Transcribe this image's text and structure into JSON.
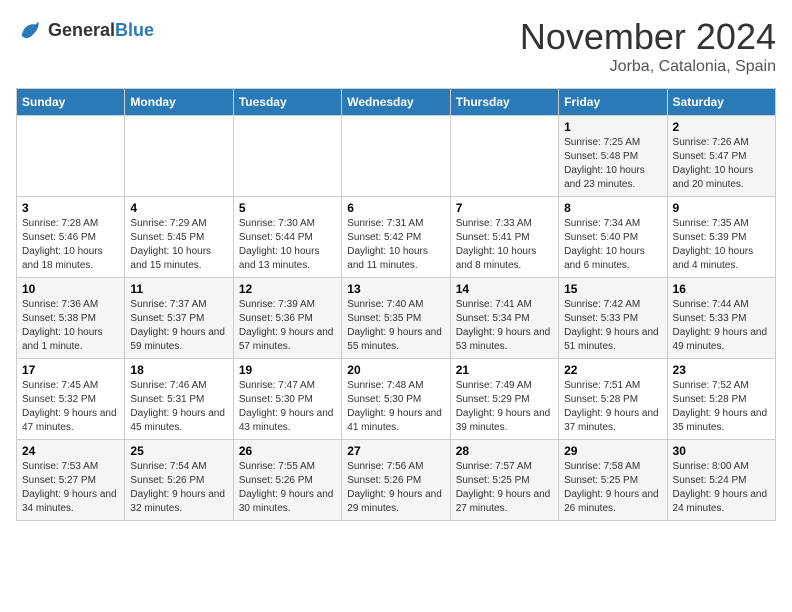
{
  "header": {
    "logo_general": "General",
    "logo_blue": "Blue",
    "month_title": "November 2024",
    "location": "Jorba, Catalonia, Spain"
  },
  "days_of_week": [
    "Sunday",
    "Monday",
    "Tuesday",
    "Wednesday",
    "Thursday",
    "Friday",
    "Saturday"
  ],
  "weeks": [
    [
      {
        "day": "",
        "info": ""
      },
      {
        "day": "",
        "info": ""
      },
      {
        "day": "",
        "info": ""
      },
      {
        "day": "",
        "info": ""
      },
      {
        "day": "",
        "info": ""
      },
      {
        "day": "1",
        "info": "Sunrise: 7:25 AM\nSunset: 5:48 PM\nDaylight: 10 hours and 23 minutes."
      },
      {
        "day": "2",
        "info": "Sunrise: 7:26 AM\nSunset: 5:47 PM\nDaylight: 10 hours and 20 minutes."
      }
    ],
    [
      {
        "day": "3",
        "info": "Sunrise: 7:28 AM\nSunset: 5:46 PM\nDaylight: 10 hours and 18 minutes."
      },
      {
        "day": "4",
        "info": "Sunrise: 7:29 AM\nSunset: 5:45 PM\nDaylight: 10 hours and 15 minutes."
      },
      {
        "day": "5",
        "info": "Sunrise: 7:30 AM\nSunset: 5:44 PM\nDaylight: 10 hours and 13 minutes."
      },
      {
        "day": "6",
        "info": "Sunrise: 7:31 AM\nSunset: 5:42 PM\nDaylight: 10 hours and 11 minutes."
      },
      {
        "day": "7",
        "info": "Sunrise: 7:33 AM\nSunset: 5:41 PM\nDaylight: 10 hours and 8 minutes."
      },
      {
        "day": "8",
        "info": "Sunrise: 7:34 AM\nSunset: 5:40 PM\nDaylight: 10 hours and 6 minutes."
      },
      {
        "day": "9",
        "info": "Sunrise: 7:35 AM\nSunset: 5:39 PM\nDaylight: 10 hours and 4 minutes."
      }
    ],
    [
      {
        "day": "10",
        "info": "Sunrise: 7:36 AM\nSunset: 5:38 PM\nDaylight: 10 hours and 1 minute."
      },
      {
        "day": "11",
        "info": "Sunrise: 7:37 AM\nSunset: 5:37 PM\nDaylight: 9 hours and 59 minutes."
      },
      {
        "day": "12",
        "info": "Sunrise: 7:39 AM\nSunset: 5:36 PM\nDaylight: 9 hours and 57 minutes."
      },
      {
        "day": "13",
        "info": "Sunrise: 7:40 AM\nSunset: 5:35 PM\nDaylight: 9 hours and 55 minutes."
      },
      {
        "day": "14",
        "info": "Sunrise: 7:41 AM\nSunset: 5:34 PM\nDaylight: 9 hours and 53 minutes."
      },
      {
        "day": "15",
        "info": "Sunrise: 7:42 AM\nSunset: 5:33 PM\nDaylight: 9 hours and 51 minutes."
      },
      {
        "day": "16",
        "info": "Sunrise: 7:44 AM\nSunset: 5:33 PM\nDaylight: 9 hours and 49 minutes."
      }
    ],
    [
      {
        "day": "17",
        "info": "Sunrise: 7:45 AM\nSunset: 5:32 PM\nDaylight: 9 hours and 47 minutes."
      },
      {
        "day": "18",
        "info": "Sunrise: 7:46 AM\nSunset: 5:31 PM\nDaylight: 9 hours and 45 minutes."
      },
      {
        "day": "19",
        "info": "Sunrise: 7:47 AM\nSunset: 5:30 PM\nDaylight: 9 hours and 43 minutes."
      },
      {
        "day": "20",
        "info": "Sunrise: 7:48 AM\nSunset: 5:30 PM\nDaylight: 9 hours and 41 minutes."
      },
      {
        "day": "21",
        "info": "Sunrise: 7:49 AM\nSunset: 5:29 PM\nDaylight: 9 hours and 39 minutes."
      },
      {
        "day": "22",
        "info": "Sunrise: 7:51 AM\nSunset: 5:28 PM\nDaylight: 9 hours and 37 minutes."
      },
      {
        "day": "23",
        "info": "Sunrise: 7:52 AM\nSunset: 5:28 PM\nDaylight: 9 hours and 35 minutes."
      }
    ],
    [
      {
        "day": "24",
        "info": "Sunrise: 7:53 AM\nSunset: 5:27 PM\nDaylight: 9 hours and 34 minutes."
      },
      {
        "day": "25",
        "info": "Sunrise: 7:54 AM\nSunset: 5:26 PM\nDaylight: 9 hours and 32 minutes."
      },
      {
        "day": "26",
        "info": "Sunrise: 7:55 AM\nSunset: 5:26 PM\nDaylight: 9 hours and 30 minutes."
      },
      {
        "day": "27",
        "info": "Sunrise: 7:56 AM\nSunset: 5:26 PM\nDaylight: 9 hours and 29 minutes."
      },
      {
        "day": "28",
        "info": "Sunrise: 7:57 AM\nSunset: 5:25 PM\nDaylight: 9 hours and 27 minutes."
      },
      {
        "day": "29",
        "info": "Sunrise: 7:58 AM\nSunset: 5:25 PM\nDaylight: 9 hours and 26 minutes."
      },
      {
        "day": "30",
        "info": "Sunrise: 8:00 AM\nSunset: 5:24 PM\nDaylight: 9 hours and 24 minutes."
      }
    ]
  ]
}
